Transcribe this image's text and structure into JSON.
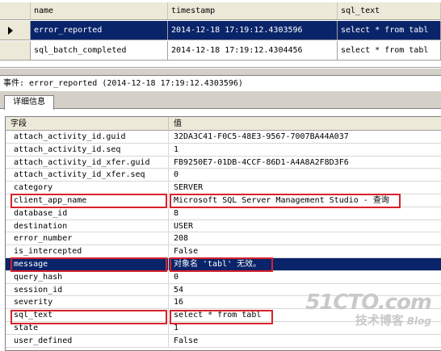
{
  "events_grid": {
    "columns": [
      "name",
      "timestamp",
      "sql_text"
    ],
    "rows": [
      {
        "name": "error_reported",
        "timestamp": "2014-12-18 17:19:12.4303596",
        "sql_text": "select * from tabl"
      },
      {
        "name": "sql_batch_completed",
        "timestamp": "2014-12-18 17:19:12.4304456",
        "sql_text": "select * from tabl"
      }
    ]
  },
  "event_title": "事件: error_reported (2014-12-18 17:19:12.4303596)",
  "tab_label": "详细信息",
  "details": {
    "header_field": "字段",
    "header_value": "值",
    "rows": [
      {
        "field": "attach_activity_id.guid",
        "value": "32DA3C41-F0C5-48E3-9567-7007BA44A037"
      },
      {
        "field": "attach_activity_id.seq",
        "value": "1"
      },
      {
        "field": "attach_activity_id_xfer.guid",
        "value": "FB9250E7-01DB-4CCF-86D1-A4A8A2F8D3F6"
      },
      {
        "field": "attach_activity_id_xfer.seq",
        "value": "0"
      },
      {
        "field": "category",
        "value": "SERVER"
      },
      {
        "field": "client_app_name",
        "value": "Microsoft SQL Server Management Studio - 查询"
      },
      {
        "field": "database_id",
        "value": "8"
      },
      {
        "field": "destination",
        "value": "USER"
      },
      {
        "field": "error_number",
        "value": "208"
      },
      {
        "field": "is_intercepted",
        "value": "False"
      },
      {
        "field": "message",
        "value": "对象名 'tabl' 无效。"
      },
      {
        "field": "query_hash",
        "value": "0"
      },
      {
        "field": "session_id",
        "value": "54"
      },
      {
        "field": "severity",
        "value": "16"
      },
      {
        "field": "sql_text",
        "value": "select * from tabl"
      },
      {
        "field": "state",
        "value": "1"
      },
      {
        "field": "user_defined",
        "value": "False"
      }
    ]
  },
  "watermark": {
    "logo": "51CTO.com",
    "sub": "技术博客",
    "blog": "Blog"
  },
  "colors": {
    "selection": "#0a246a",
    "highlight_box": "#d8222b",
    "header_bg": "#ece9d8"
  }
}
